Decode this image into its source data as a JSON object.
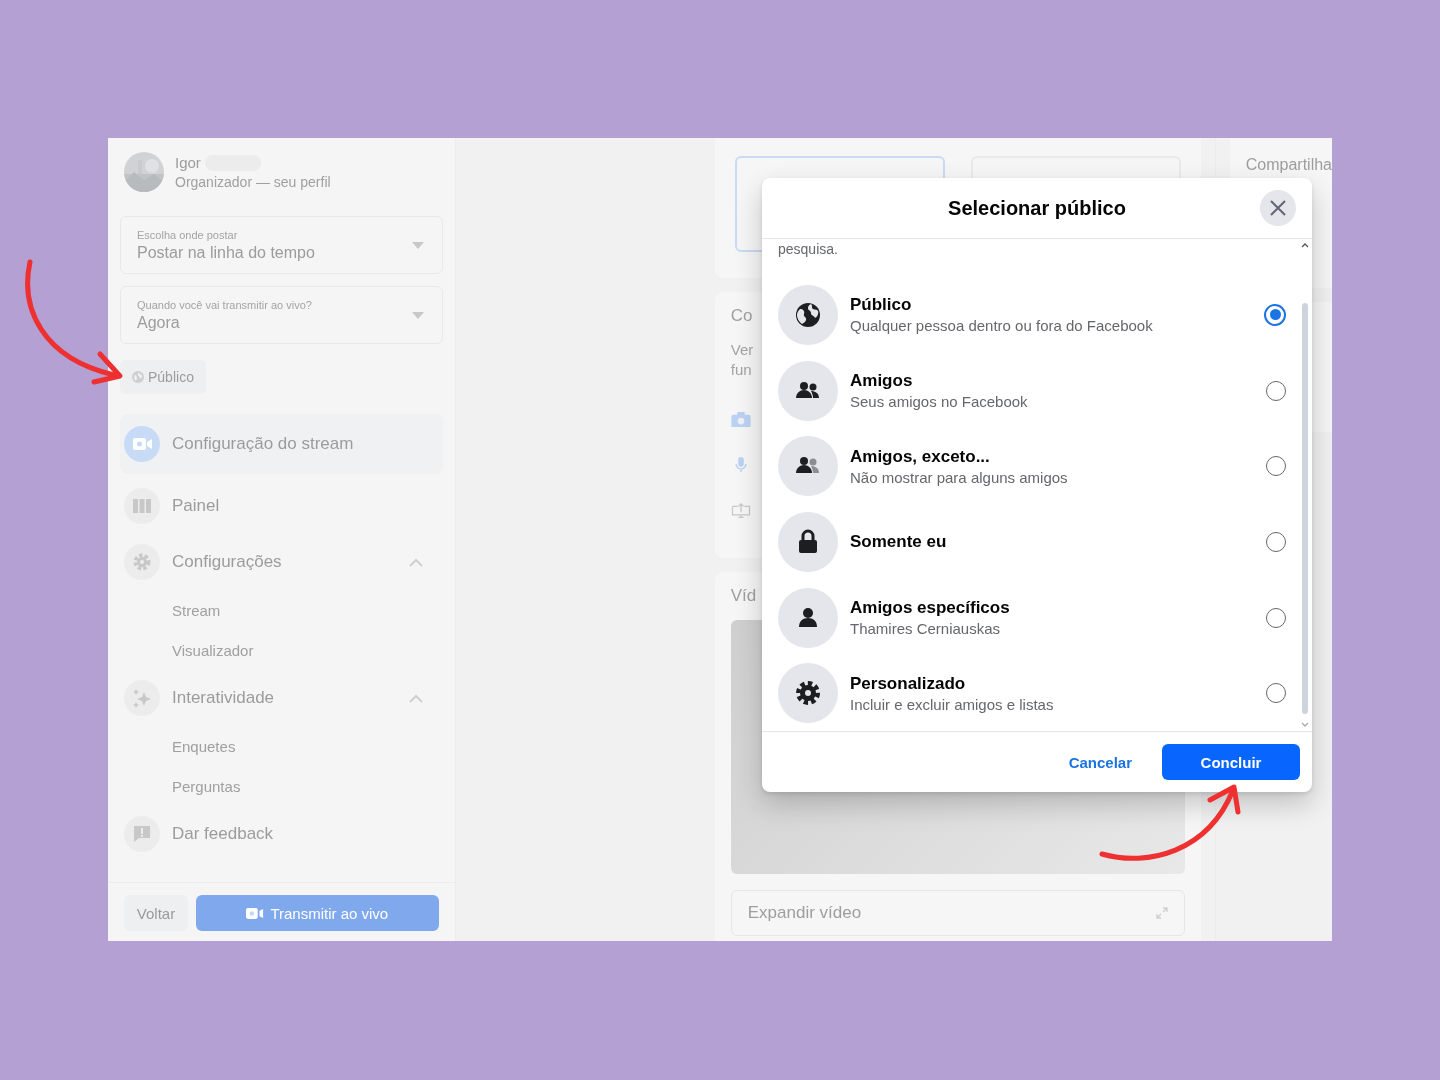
{
  "sidebar": {
    "user": {
      "name": "Igor",
      "role": "Organizador — seu perfil"
    },
    "fields": [
      {
        "label": "Escolha onde postar",
        "value": "Postar na linha do tempo"
      },
      {
        "label": "Quando você vai transmitir ao vivo?",
        "value": "Agora"
      }
    ],
    "audience_button": "Público",
    "nav": [
      {
        "kind": "camera",
        "label": "Configuração do stream",
        "selected": true
      },
      {
        "kind": "columns",
        "label": "Painel",
        "selected": false
      },
      {
        "kind": "gear",
        "label": "Configurações",
        "selected": false,
        "expanded": true,
        "children": [
          {
            "label": "Stream"
          },
          {
            "label": "Visualizador"
          }
        ]
      },
      {
        "kind": "sparkle",
        "label": "Interatividade",
        "selected": false,
        "expanded": true,
        "children": [
          {
            "label": "Enquetes"
          },
          {
            "label": "Perguntas"
          }
        ]
      },
      {
        "kind": "feedback",
        "label": "Dar feedback",
        "selected": false
      }
    ],
    "back_button": "Voltar",
    "go_live_button": "Transmitir ao vivo"
  },
  "main": {
    "card_title": "Co",
    "card_lines": [
      "Ver",
      "fun"
    ],
    "video_title": "Víd",
    "expand_video": "Expandir vídeo"
  },
  "right_panel": {
    "title": "Compartilha"
  },
  "dialog": {
    "title": "Selecionar público",
    "intro_tail": "pesquisa.",
    "options": [
      {
        "kind": "globe",
        "title": "Público",
        "subtitle": "Qualquer pessoa dentro ou fora do Facebook",
        "selected": true
      },
      {
        "kind": "friends",
        "title": "Amigos",
        "subtitle": "Seus amigos no Facebook",
        "selected": false
      },
      {
        "kind": "friends-except",
        "title": "Amigos, exceto...",
        "subtitle": "Não mostrar para alguns amigos",
        "selected": false
      },
      {
        "kind": "lock",
        "title": "Somente eu",
        "selected": false
      },
      {
        "kind": "person",
        "title": "Amigos específicos",
        "subtitle": "Thamires Cerniauskas",
        "selected": false
      },
      {
        "kind": "gear",
        "title": "Personalizado",
        "subtitle": "Incluir e excluir amigos e listas",
        "selected": false
      }
    ],
    "cancel": "Cancelar",
    "confirm": "Concluir"
  }
}
